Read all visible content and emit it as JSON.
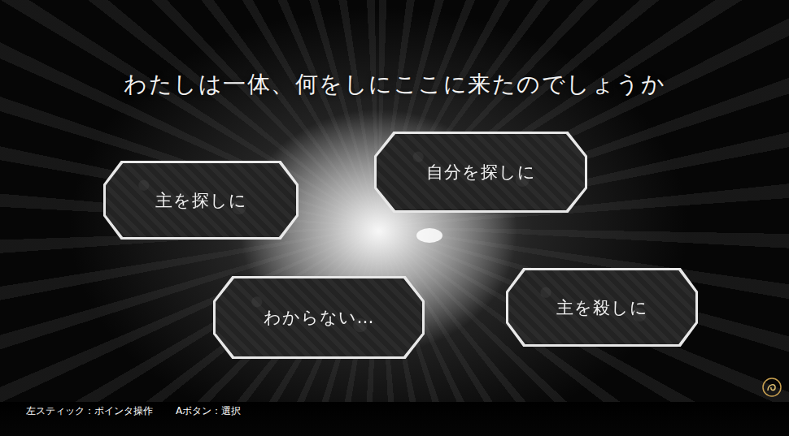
{
  "prompt": "わたしは一体、何をしにここに来たのでしょうか",
  "choices": [
    {
      "label": "主を探しに"
    },
    {
      "label": "自分を探しに"
    },
    {
      "label": "わからない…"
    },
    {
      "label": "主を殺しに"
    }
  ],
  "controls": [
    {
      "label": "左スティック：ポインタ操作"
    },
    {
      "label": "Aボタン：選択"
    }
  ]
}
